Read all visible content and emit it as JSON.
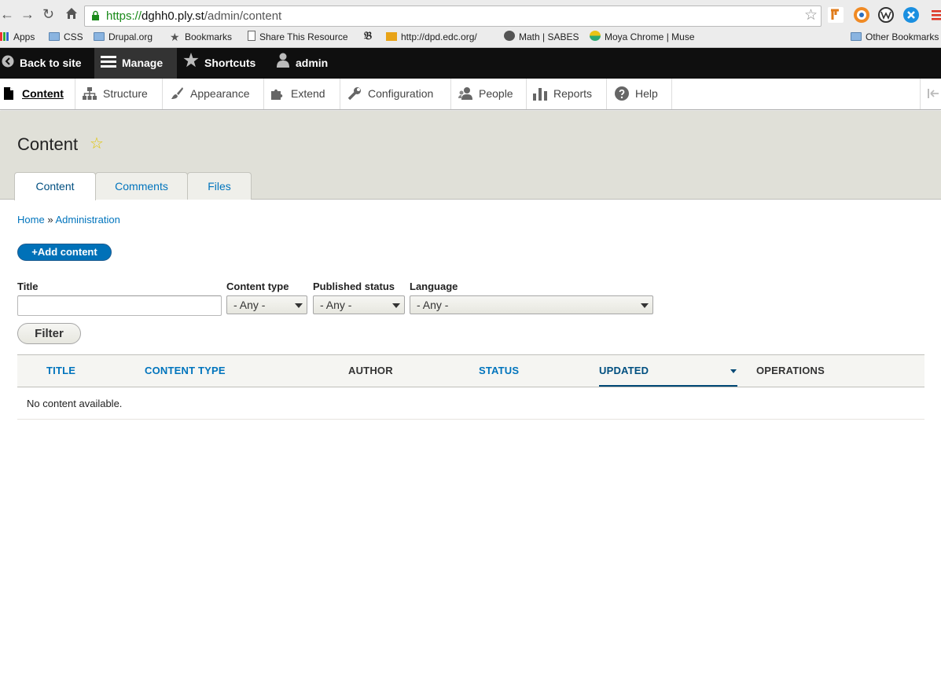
{
  "browser": {
    "url_scheme": "https://",
    "url_host": "dghh0.ply.st",
    "url_path": "/admin/content",
    "bookmarks": [
      {
        "label": "Apps",
        "icon": "apps-grid-icon"
      },
      {
        "label": "CSS",
        "icon": "folder-icon"
      },
      {
        "label": "Drupal.org",
        "icon": "folder-icon"
      },
      {
        "label": "Bookmarks",
        "icon": "star-icon"
      },
      {
        "label": "Share This Resource",
        "icon": "page-icon"
      },
      {
        "label": "http://dpd.edc.org/",
        "icon": "site-icon"
      },
      {
        "label": "Math | SABES",
        "icon": "site-icon"
      },
      {
        "label": "Moya Chrome | Muse",
        "icon": "site-icon"
      },
      {
        "label": "Other Bookmarks",
        "icon": "folder-icon"
      }
    ]
  },
  "toolbar": {
    "back_to_site": "Back to site",
    "manage": "Manage",
    "shortcuts": "Shortcuts",
    "user": "admin"
  },
  "tray": {
    "items": [
      {
        "label": "Content",
        "icon": "file-icon"
      },
      {
        "label": "Structure",
        "icon": "sitemap-icon"
      },
      {
        "label": "Appearance",
        "icon": "paintbrush-icon"
      },
      {
        "label": "Extend",
        "icon": "puzzle-icon"
      },
      {
        "label": "Configuration",
        "icon": "wrench-icon"
      },
      {
        "label": "People",
        "icon": "people-icon"
      },
      {
        "label": "Reports",
        "icon": "bar-chart-icon"
      },
      {
        "label": "Help",
        "icon": "help-icon"
      }
    ]
  },
  "page": {
    "title": "Content",
    "tabs": [
      "Content",
      "Comments",
      "Files"
    ],
    "breadcrumb": {
      "home": "Home",
      "sep": "»",
      "current": "Administration"
    },
    "add_button": "+Add content"
  },
  "filters": {
    "title_label": "Title",
    "title_value": "",
    "content_type_label": "Content type",
    "content_type_value": "- Any -",
    "published_label": "Published status",
    "published_value": "- Any -",
    "language_label": "Language",
    "language_value": "- Any -",
    "filter_button": "Filter"
  },
  "table": {
    "columns": [
      "Title",
      "Content type",
      "Author",
      "Status",
      "Updated",
      "Operations"
    ],
    "sorted_column": "Updated",
    "sort_direction": "descending",
    "empty_message": "No content available."
  },
  "colors": {
    "link": "#0074bd",
    "toolbar_bg": "#0f0f0f",
    "header_bg": "#e0e0d8",
    "add_button_bg": "#0071b8"
  }
}
